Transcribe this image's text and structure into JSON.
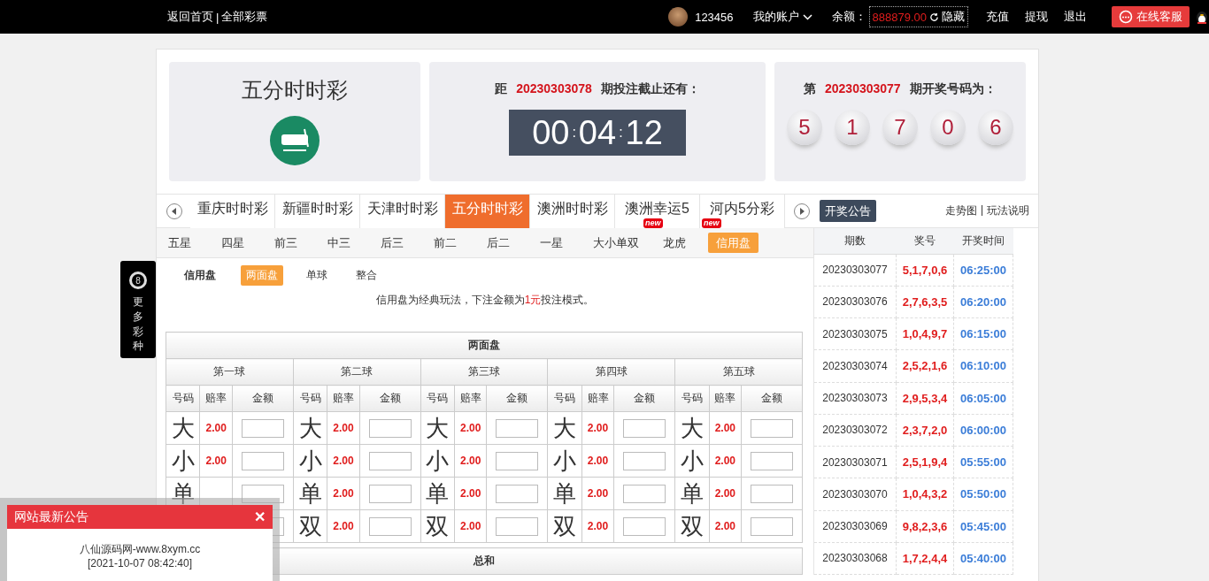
{
  "topbar": {
    "links": [
      "返回首页",
      "全部彩票"
    ],
    "link_separator": "|",
    "username": "123456",
    "account_menu": "我的账户",
    "balance_label": "余额：",
    "balance": "888879.00",
    "hide_label": "隐藏",
    "actions": [
      "充值",
      "提现",
      "退出"
    ],
    "service_button": "在线客服"
  },
  "header": {
    "game_title": "五分时时彩",
    "countdown": {
      "prefix": "距",
      "issue": "20230303078",
      "suffix": "期投注截止还有：",
      "hours": "00",
      "separator": ":",
      "minutes": "04",
      "separator_2": ":",
      "seconds": "12"
    },
    "result": {
      "prefix": "第",
      "issue": "20230303077",
      "suffix": "期开奖号码为：",
      "balls": [
        "5",
        "1",
        "7",
        "0",
        "6"
      ]
    }
  },
  "lottery_tabs": [
    {
      "label": "重庆时时彩",
      "selected": false
    },
    {
      "label": "新疆时时彩",
      "selected": false
    },
    {
      "label": "天津时时彩",
      "selected": false
    },
    {
      "label": "五分时时彩",
      "selected": true
    },
    {
      "label": "澳洲时时彩",
      "selected": false
    },
    {
      "label": "澳洲幸运5",
      "selected": false,
      "badge": "new"
    },
    {
      "label": "河内5分彩",
      "selected": false,
      "badge": "new"
    }
  ],
  "announce_button": "开奖公告",
  "trend_links": [
    "走势图",
    "玩法说明"
  ],
  "trend_separator": "|",
  "play_tabs": [
    {
      "label": "五星",
      "selected": false
    },
    {
      "label": "四星",
      "selected": false
    },
    {
      "label": "前三",
      "selected": false
    },
    {
      "label": "中三",
      "selected": false
    },
    {
      "label": "后三",
      "selected": false
    },
    {
      "label": "前二",
      "selected": false
    },
    {
      "label": "后二",
      "selected": false
    },
    {
      "label": "一星",
      "selected": false
    },
    {
      "label": "大小单双",
      "selected": false
    },
    {
      "label": "龙虎",
      "selected": false
    },
    {
      "label": "信用盘",
      "selected": true
    }
  ],
  "mode": {
    "label": "信用盘",
    "options": [
      {
        "label": "两面盘",
        "selected": true
      },
      {
        "label": "单球",
        "selected": false
      },
      {
        "label": "整合",
        "selected": false
      }
    ]
  },
  "notice": {
    "before": "信用盘为经典玩法，下注金额为",
    "highlight": "1元",
    "after": "投注模式。"
  },
  "bet_table": {
    "title": "两面盘",
    "groups": [
      {
        "name": "第一球",
        "columns": [
          "号码",
          "赔率",
          "金额"
        ],
        "rows": [
          {
            "label": "大",
            "odds": "2.00"
          },
          {
            "label": "小",
            "odds": "2.00"
          },
          {
            "label": "单"
          },
          {}
        ]
      },
      {
        "name": "第二球",
        "columns": [
          "号码",
          "赔率",
          "金额"
        ],
        "rows": [
          {
            "label": "大",
            "odds": "2.00"
          },
          {
            "label": "小",
            "odds": "2.00"
          },
          {
            "label": "单",
            "odds": "2.00"
          },
          {
            "label": "双",
            "odds": "2.00"
          }
        ]
      },
      {
        "name": "第三球",
        "columns": [
          "号码",
          "赔率",
          "金额"
        ],
        "rows": [
          {
            "label": "大",
            "odds": "2.00"
          },
          {
            "label": "小",
            "odds": "2.00"
          },
          {
            "label": "单",
            "odds": "2.00"
          },
          {
            "label": "双",
            "odds": "2.00"
          }
        ]
      },
      {
        "name": "第四球",
        "columns": [
          "号码",
          "赔率",
          "金额"
        ],
        "rows": [
          {
            "label": "大",
            "odds": "2.00"
          },
          {
            "label": "小",
            "odds": "2.00"
          },
          {
            "label": "单",
            "odds": "2.00"
          },
          {
            "label": "双",
            "odds": "2.00"
          }
        ]
      },
      {
        "name": "第五球",
        "columns": [
          "号码",
          "赔率",
          "金额"
        ],
        "rows": [
          {
            "label": "大",
            "odds": "2.00"
          },
          {
            "label": "小",
            "odds": "2.00"
          },
          {
            "label": "单",
            "odds": "2.00"
          },
          {
            "label": "双",
            "odds": "2.00"
          }
        ]
      }
    ],
    "next_title": "总和"
  },
  "history": {
    "columns": [
      "期数",
      "奖号",
      "开奖时间"
    ],
    "rows": [
      {
        "issue": "20230303077",
        "numbers": "5,1,7,0,6",
        "time": "06:25:00"
      },
      {
        "issue": "20230303076",
        "numbers": "2,7,6,3,5",
        "time": "06:20:00"
      },
      {
        "issue": "20230303075",
        "numbers": "1,0,4,9,7",
        "time": "06:15:00"
      },
      {
        "issue": "20230303074",
        "numbers": "2,5,2,1,6",
        "time": "06:10:00"
      },
      {
        "issue": "20230303073",
        "numbers": "2,9,5,3,4",
        "time": "06:05:00"
      },
      {
        "issue": "20230303072",
        "numbers": "2,3,7,2,0",
        "time": "06:00:00"
      },
      {
        "issue": "20230303071",
        "numbers": "2,5,1,9,4",
        "time": "05:55:00"
      },
      {
        "issue": "20230303070",
        "numbers": "1,0,4,3,2",
        "time": "05:50:00"
      },
      {
        "issue": "20230303069",
        "numbers": "9,8,2,3,6",
        "time": "05:45:00"
      },
      {
        "issue": "20230303068",
        "numbers": "1,7,2,4,4",
        "time": "05:40:00"
      }
    ]
  },
  "side_float": {
    "ball": "8",
    "label": "更多彩种"
  },
  "popup": {
    "title": "网站最新公告",
    "close": "✕",
    "lines": [
      "八仙源码网-www.8xym.cc",
      "[2021-10-07 08:42:40]"
    ]
  }
}
